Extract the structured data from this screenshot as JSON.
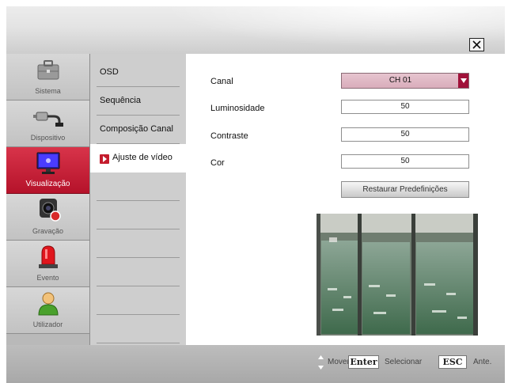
{
  "sidebar": {
    "items": [
      {
        "label": "Sistema",
        "icon": "system-tools-icon"
      },
      {
        "label": "Dispositivo",
        "icon": "device-cable-icon"
      },
      {
        "label": "Visualização",
        "icon": "display-monitor-icon",
        "active": true
      },
      {
        "label": "Gravação",
        "icon": "record-camera-icon"
      },
      {
        "label": "Evento",
        "icon": "alarm-siren-icon"
      },
      {
        "label": "Utilizador",
        "icon": "user-icon"
      }
    ]
  },
  "submenu": {
    "items": [
      {
        "label": "OSD"
      },
      {
        "label": "Sequência"
      },
      {
        "label": "Composição Canal"
      },
      {
        "label": "Ajuste de vídeo",
        "active": true
      }
    ]
  },
  "form": {
    "canal_label": "Canal",
    "canal_value": "CH 01",
    "luminosidade_label": "Luminosidade",
    "luminosidade_value": "50",
    "contraste_label": "Contraste",
    "contraste_value": "50",
    "cor_label": "Cor",
    "cor_value": "50",
    "restore_label": "Restaurar Predefinições"
  },
  "footer": {
    "move_label": "Mover",
    "enter_key": "Enter",
    "select_label": "Selecionar",
    "esc_key": "ESC",
    "back_label": "Ante."
  },
  "colors": {
    "accent_active": "#c41d2d",
    "select_bg": "#dcb3c0",
    "dropdown_button": "#a0123a"
  }
}
